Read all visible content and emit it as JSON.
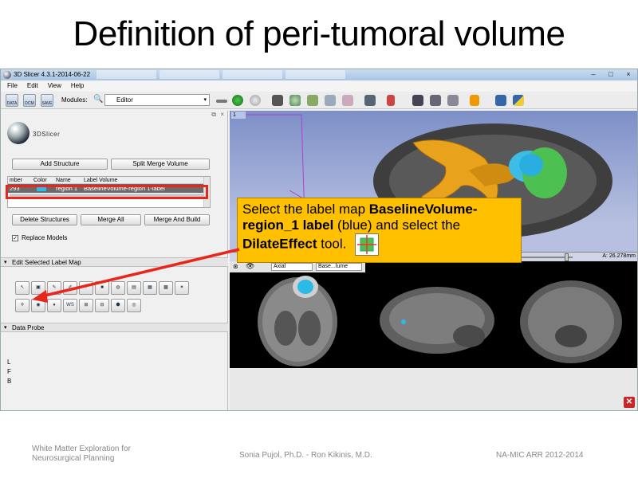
{
  "slide": {
    "title": "Definition of peri-tumoral volume",
    "footer_left_line1": "White Matter Exploration for",
    "footer_left_line2": "Neurosurgical Planning",
    "footer_center": "Sonia Pujol, Ph.D. - Ron Kikinis, M.D.",
    "footer_right": "NA-MIC ARR 2012-2014"
  },
  "app": {
    "window_title": "3D Slicer 4.3.1-2014-06-22",
    "menu": [
      "File",
      "Edit",
      "View",
      "Help"
    ],
    "toolbar": {
      "data_label": "DATA",
      "dcm_label": "DCM",
      "save_label": "SAVE",
      "modules_label": "Modules:",
      "module_selected": "Editor"
    },
    "logo_text": "3DSlicer",
    "buttons": {
      "add_structure": "Add Structure",
      "split_merge": "Split Merge Volume",
      "delete_structures": "Delete Structures",
      "merge_all": "Merge All",
      "merge_and_build": "Merge And Build"
    },
    "structure_table": {
      "columns": [
        "mber",
        "Color",
        "Name",
        "Label Volume"
      ],
      "rows": [
        {
          "number": "293",
          "name": "region 1",
          "label_volume": "BaselineVolume-region 1-label"
        }
      ]
    },
    "replace_models_label": "Replace Models",
    "sections": {
      "edit_label_map": "Edit Selected Label Map",
      "data_probe": "Data Probe"
    },
    "data_probe_letters": [
      "L",
      "F",
      "B"
    ],
    "view3d_tag": "1",
    "slice": {
      "orientation": "Axial",
      "volume": "Base...lume",
      "offset_value": "A: 26.278mm"
    },
    "callout": {
      "text_1": "Select the label map ",
      "bold_1": "BaselineVolume-region_1 label",
      "text_2": " (blue) and select the ",
      "bold_2": "DilateEffect",
      "text_3": " tool."
    },
    "colors": {
      "callout_bg": "#ffc000",
      "highlight_red": "#e8261c",
      "label_blue": "#2bbbe8"
    }
  }
}
